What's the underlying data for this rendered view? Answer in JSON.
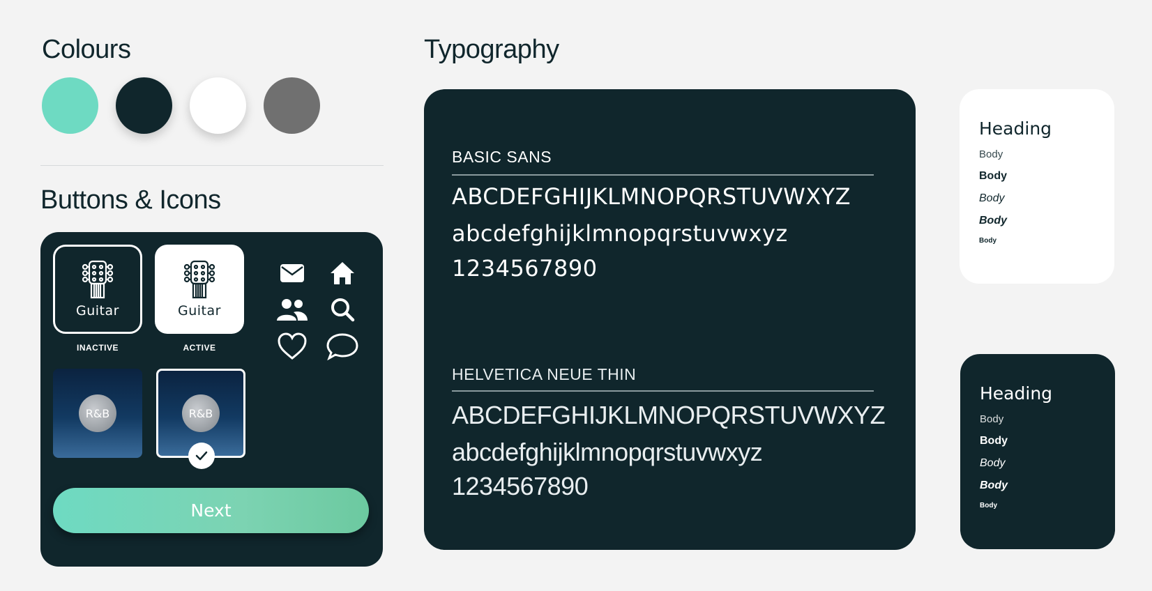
{
  "colours": {
    "title": "Colours",
    "swatches": [
      {
        "name": "mint",
        "color": "#6edac2"
      },
      {
        "name": "dark-teal",
        "color": "#10262c"
      },
      {
        "name": "white",
        "color": "#ffffff"
      },
      {
        "name": "grey",
        "color": "#707070"
      }
    ]
  },
  "buttons": {
    "title": "Buttons & Icons",
    "tile_inactive": {
      "label": "Guitar",
      "state": "INACTIVE",
      "icon": "guitar-headstock-icon"
    },
    "tile_active": {
      "label": "Guitar",
      "state": "ACTIVE",
      "icon": "guitar-headstock-icon"
    },
    "genres": [
      {
        "label": "R&B",
        "selected": false
      },
      {
        "label": "R&B",
        "selected": true
      }
    ],
    "icons": [
      "mail-icon",
      "home-icon",
      "people-icon",
      "search-icon",
      "heart-icon",
      "chat-icon"
    ],
    "next_label": "Next"
  },
  "typography": {
    "title": "Typography",
    "fonts": [
      {
        "name": "BASIC SANS",
        "upper": "ABCDEFGHIJKLMNOPQRSTUVWXYZ",
        "lower": "abcdefghijklmnopqrstuvwxyz",
        "digits": "1234567890"
      },
      {
        "name": "HELVETICA NEUE THIN",
        "upper": "ABCDEFGHIJKLMNOPQRSTUVWXYZ",
        "lower": "abcdefghijklmnopqrstuvwxyz",
        "digits": "1234567890"
      }
    ],
    "styles": {
      "heading": "Heading",
      "body": "Body"
    }
  },
  "accent": "#6edac2",
  "dark": "#10262c"
}
